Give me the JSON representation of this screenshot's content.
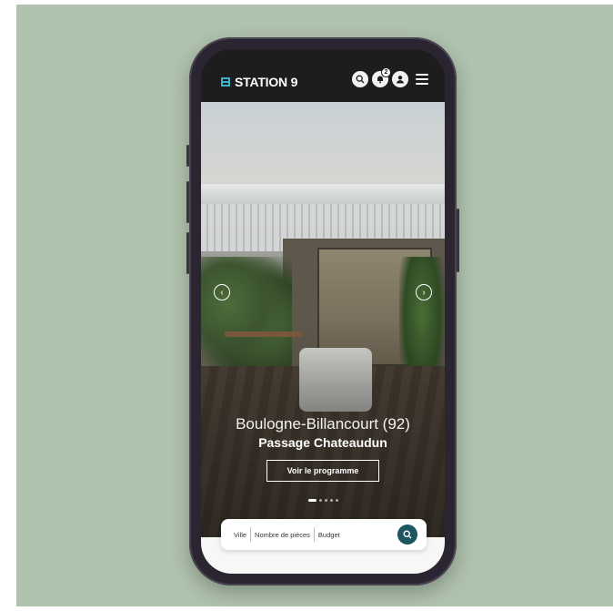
{
  "header": {
    "logo_text": "STATION 9",
    "notification_count": "2"
  },
  "hero": {
    "city": "Boulogne-Billancourt (92)",
    "program_name": "Passage Chateaudun",
    "cta_label": "Voir le programme",
    "slide_count": 5,
    "active_slide": 1
  },
  "search": {
    "city_label": "Ville",
    "rooms_label": "Nombre de pièces",
    "budget_label": "Budget"
  },
  "colors": {
    "background": "#afc2ad",
    "accent": "#1d5561",
    "logo_accent": "#39b3c5"
  }
}
